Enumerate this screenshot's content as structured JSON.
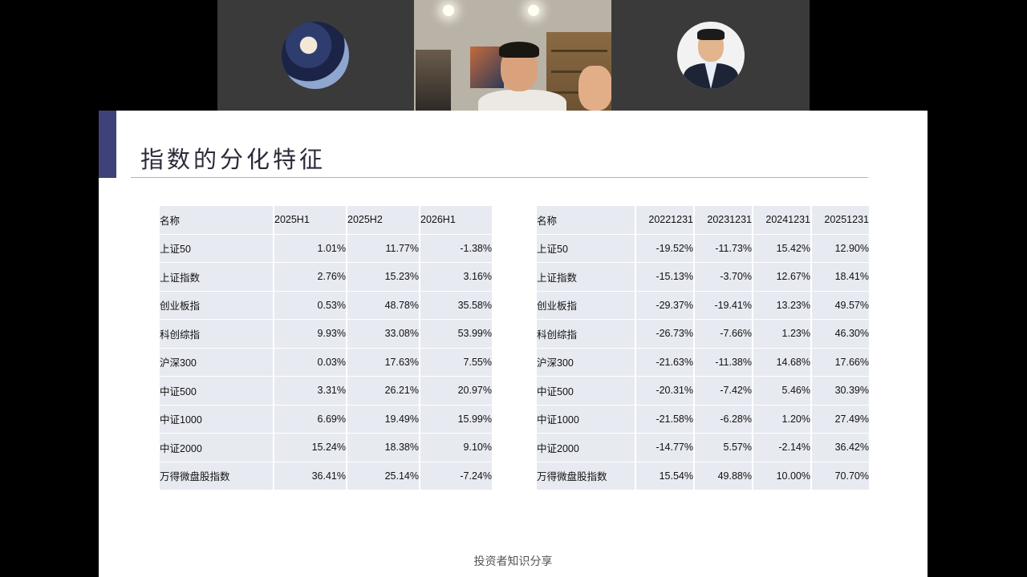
{
  "slide": {
    "title": "指数的分化特征",
    "footer": "投资者知识分享"
  },
  "left_table": {
    "headers": [
      "名称",
      "2025H1",
      "2025H2",
      "2026H1"
    ],
    "rows": [
      [
        "上证50",
        "1.01%",
        "11.77%",
        "-1.38%"
      ],
      [
        "上证指数",
        "2.76%",
        "15.23%",
        "3.16%"
      ],
      [
        "创业板指",
        "0.53%",
        "48.78%",
        "35.58%"
      ],
      [
        "科创综指",
        "9.93%",
        "33.08%",
        "53.99%"
      ],
      [
        "沪深300",
        "0.03%",
        "17.63%",
        "7.55%"
      ],
      [
        "中证500",
        "3.31%",
        "26.21%",
        "20.97%"
      ],
      [
        "中证1000",
        "6.69%",
        "19.49%",
        "15.99%"
      ],
      [
        "中证2000",
        "15.24%",
        "18.38%",
        "9.10%"
      ],
      [
        "万得微盘股指数",
        "36.41%",
        "25.14%",
        "-7.24%"
      ]
    ]
  },
  "right_table": {
    "headers": [
      "名称",
      "20221231",
      "20231231",
      "20241231",
      "20251231"
    ],
    "rows": [
      [
        "上证50",
        "-19.52%",
        "-11.73%",
        "15.42%",
        "12.90%"
      ],
      [
        "上证指数",
        "-15.13%",
        "-3.70%",
        "12.67%",
        "18.41%"
      ],
      [
        "创业板指",
        "-29.37%",
        "-19.41%",
        "13.23%",
        "49.57%"
      ],
      [
        "科创综指",
        "-26.73%",
        "-7.66%",
        "1.23%",
        "46.30%"
      ],
      [
        "沪深300",
        "-21.63%",
        "-11.38%",
        "14.68%",
        "17.66%"
      ],
      [
        "中证500",
        "-20.31%",
        "-7.42%",
        "5.46%",
        "30.39%"
      ],
      [
        "中证1000",
        "-21.58%",
        "-6.28%",
        "1.20%",
        "27.49%"
      ],
      [
        "中证2000",
        "-14.77%",
        "5.57%",
        "-2.14%",
        "36.42%"
      ],
      [
        "万得微盘股指数",
        "15.54%",
        "49.88%",
        "10.00%",
        "70.70%"
      ]
    ]
  },
  "participants": [
    {
      "kind": "avatar",
      "icon": "anime-avatar-icon"
    },
    {
      "kind": "video",
      "icon": "camera-video-feed"
    },
    {
      "kind": "avatar",
      "icon": "profile-photo-avatar-icon"
    }
  ],
  "colors": {
    "accent": "#3f4278",
    "cell_bg": "#e8eaf2",
    "tile_bg": "#3a3a3a"
  }
}
